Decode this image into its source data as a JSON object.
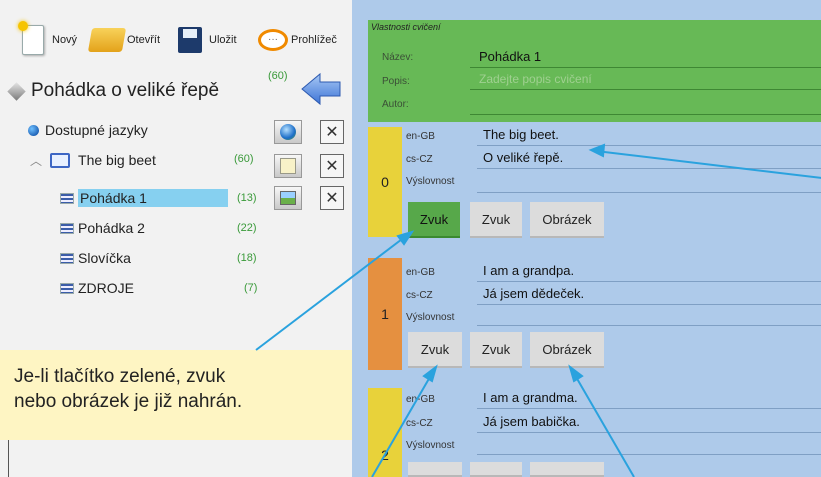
{
  "toolbar": {
    "new_label": "Nový",
    "open_label": "Otevřít",
    "save_label": "Uložit",
    "viewer_label": "Prohlížeč"
  },
  "project": {
    "title": "Pohádka o veliké řepě",
    "count": "(60)"
  },
  "tree": {
    "languages_label": "Dostupné jazyky",
    "book": {
      "label": "The big beet",
      "count": "(60)"
    },
    "items": [
      {
        "label": "Pohádka 1",
        "count": "(13)",
        "selected": true
      },
      {
        "label": "Pohádka 2",
        "count": "(22)"
      },
      {
        "label": "Slovíčka",
        "count": "(18)"
      },
      {
        "label": "ZDROJE",
        "count": "(7)"
      }
    ]
  },
  "callout": {
    "line1": "Je-li tlačítko zelené, zvuk",
    "line2": "nebo obrázek je již nahrán."
  },
  "properties": {
    "title": "Vlastnosti cvičení",
    "name_label": "Název:",
    "name_value": "Pohádka 1",
    "desc_label": "Popis:",
    "desc_placeholder": "Zadejte popis cvičení",
    "author_label": "Autor:"
  },
  "cards": [
    {
      "index": "0",
      "color": "#e8d23a",
      "lang1": "en-GB",
      "text1": "The big beet.",
      "lang2": "cs-CZ",
      "text2": "O veliké řepě.",
      "pron_label": "Výslovnost",
      "buttons": [
        "Zvuk",
        "Zvuk",
        "Obrázek"
      ],
      "first_green": true
    },
    {
      "index": "1",
      "color": "#e59040",
      "lang1": "en-GB",
      "text1": "I am a grandpa.",
      "lang2": "cs-CZ",
      "text2": "Já jsem dědeček.",
      "pron_label": "Výslovnost",
      "buttons": [
        "Zvuk",
        "Zvuk",
        "Obrázek"
      ],
      "first_green": false
    },
    {
      "index": "2",
      "color": "#e8d23a",
      "lang1": "en-GB",
      "text1": "I am a grandma.",
      "lang2": "cs-CZ",
      "text2": "Já jsem babička.",
      "pron_label": "Výslovnost",
      "buttons": [],
      "first_green": false
    }
  ],
  "colors": {
    "panel_blue": "#aecaea",
    "props_green": "#67b956",
    "button_green": "#57a84a",
    "arrow_blue": "#2aa2de",
    "count_green": "#3a9a3a"
  }
}
